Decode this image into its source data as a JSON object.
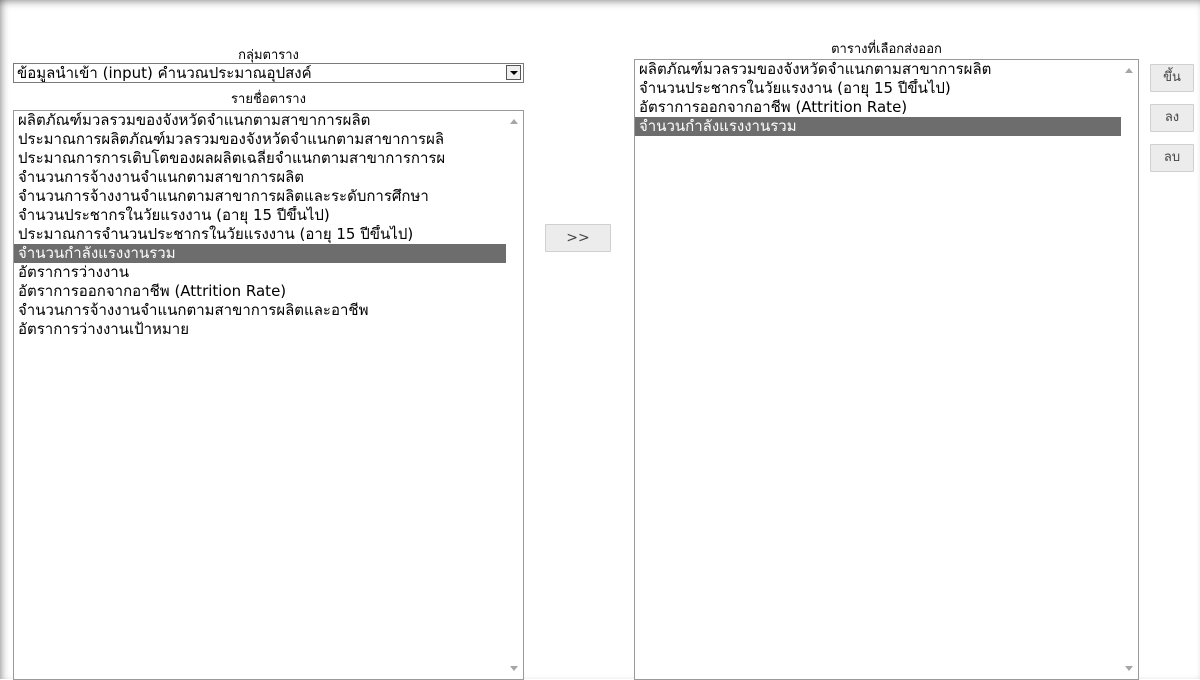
{
  "left": {
    "group_caption": "กลุ่มตาราง",
    "group_select_value": "ข้อมูลนำเข้า (input) คำนวณประมาณอุปสงค์",
    "list_caption": "รายชื่อตาราง",
    "items": [
      "ผลิตภัณฑ์มวลรวมของจังหวัดจำแนกตามสาขาการผลิต",
      "ประมาณการผลิตภัณฑ์มวลรวมของจังหวัดจำแนกตามสาขาการผลิ",
      "ประมาณการการเติบโตของผลผลิตเฉลี่ยจำแนกตามสาขาการการผ",
      "จำนวนการจ้างงานจำแนกตามสาขาการผลิต",
      "จำนวนการจ้างงานจำแนกตามสาขาการผลิตและระดับการศึกษา",
      "จำนวนประชากรในวัยแรงงาน (อายุ 15 ปีขึ้นไป)",
      "ประมาณการจำนวนประชากรในวัยแรงงาน (อายุ 15 ปีขึ้นไป)",
      "จำนวนกำลังแรงงานรวม",
      "อัตราการว่างงาน",
      "อัตราการออกจากอาชีพ (Attrition Rate)",
      "จำนวนการจ้างงานจำแนกตามสาขาการผลิตและอาชีพ",
      "อัตราการว่างงานเป้าหมาย"
    ],
    "selected_index": 7
  },
  "transfer_button_label": ">>",
  "right": {
    "caption": "ตารางที่เลือกส่งออก",
    "items": [
      "ผลิตภัณฑ์มวลรวมของจังหวัดจำแนกตามสาขาการผลิต",
      "จำนวนประชากรในวัยแรงงาน (อายุ 15 ปีขึ้นไป)",
      "อัตราการออกจากอาชีพ (Attrition Rate)",
      "จำนวนกำลังแรงงานรวม"
    ],
    "selected_index": 3
  },
  "side_buttons": {
    "up_label": "ขึ้น",
    "down_label": "ลง",
    "delete_label": "ลบ"
  },
  "colors": {
    "selected_row": "#6d6d6d",
    "button_bg": "#ececec"
  }
}
